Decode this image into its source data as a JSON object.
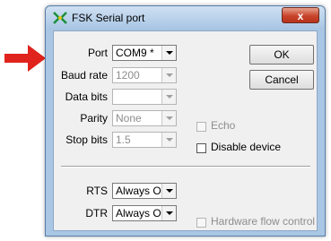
{
  "window": {
    "title": "FSK Serial port",
    "close_glyph": "x",
    "app_icon": "fsk-app-icon"
  },
  "annotation": {
    "icon": "red-arrow-right"
  },
  "fields": {
    "port": {
      "label": "Port",
      "value": "COM9 *"
    },
    "baud_rate": {
      "label": "Baud rate",
      "value": "1200"
    },
    "data_bits": {
      "label": "Data bits",
      "value": ""
    },
    "parity": {
      "label": "Parity",
      "value": "None"
    },
    "stop_bits": {
      "label": "Stop bits",
      "value": "1.5"
    },
    "rts": {
      "label": "RTS",
      "value": "Always On"
    },
    "dtr": {
      "label": "DTR",
      "value": "Always On"
    }
  },
  "buttons": {
    "ok": "OK",
    "cancel": "Cancel"
  },
  "checkboxes": {
    "echo": {
      "label": "Echo",
      "checked": false,
      "enabled": false
    },
    "disable_device": {
      "label": "Disable device",
      "checked": false,
      "enabled": true
    },
    "hardware_flow": {
      "label": "Hardware flow control",
      "checked": false,
      "enabled": false
    }
  }
}
